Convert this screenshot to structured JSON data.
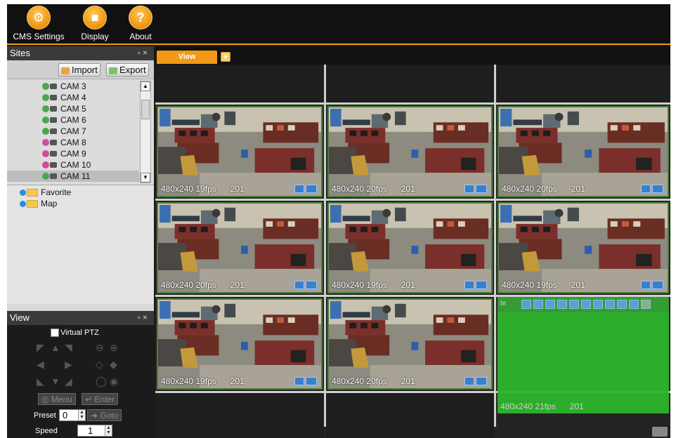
{
  "toolbar": {
    "items": [
      {
        "label": "CMS Settings",
        "icon": "gear-icon"
      },
      {
        "label": "Display",
        "icon": "video-camera-icon"
      },
      {
        "label": "About",
        "icon": "question-icon"
      }
    ]
  },
  "sites": {
    "title": "Sites",
    "import_label": "Import",
    "export_label": "Export",
    "cameras": [
      {
        "label": "CAM 3",
        "status": "#49a84b"
      },
      {
        "label": "CAM 4",
        "status": "#49a84b"
      },
      {
        "label": "CAM 5",
        "status": "#49a84b"
      },
      {
        "label": "CAM 6",
        "status": "#49a84b"
      },
      {
        "label": "CAM 7",
        "status": "#49a84b"
      },
      {
        "label": "CAM 8",
        "status": "#d04ca0"
      },
      {
        "label": "CAM 9",
        "status": "#d04ca0"
      },
      {
        "label": "CAM 10",
        "status": "#d04ca0"
      },
      {
        "label": "CAM 11",
        "status": "#49a84b"
      }
    ],
    "selected_camera": "CAM 11",
    "tree": [
      "Favorite",
      "Map"
    ]
  },
  "view_panel": {
    "title": "View",
    "virtual_ptz_label": "Virtual PTZ",
    "menu_label": "Menu",
    "enter_label": "Enter",
    "preset_label": "Preset",
    "preset_value": "0",
    "goto_label": "Goto",
    "speed_label": "Speed",
    "speed_value": "1"
  },
  "tabs": {
    "active": "View",
    "add_label": "+"
  },
  "grid": {
    "tiles": [
      {
        "res": "480x240",
        "fps": "19fps",
        "ts": "201"
      },
      {
        "res": "480x240",
        "fps": "20fps",
        "ts": "201"
      },
      {
        "res": "480x240",
        "fps": "20fps",
        "ts": "201"
      },
      {
        "res": "480x240",
        "fps": "20fps",
        "ts": "201"
      },
      {
        "res": "480x240",
        "fps": "19fps",
        "ts": "201"
      },
      {
        "res": "480x240",
        "fps": "19fps",
        "ts": "201"
      },
      {
        "res": "480x240",
        "fps": "19fps",
        "ts": "201"
      },
      {
        "res": "480x240",
        "fps": "20fps",
        "ts": "201"
      }
    ],
    "active_tile": {
      "label": "te",
      "res": "480x240",
      "fps": "21fps",
      "ts": "201"
    }
  },
  "colors": {
    "accent": "#f29a16",
    "active_tile": "#2db52c",
    "tile_border": "#4c7f3a"
  }
}
